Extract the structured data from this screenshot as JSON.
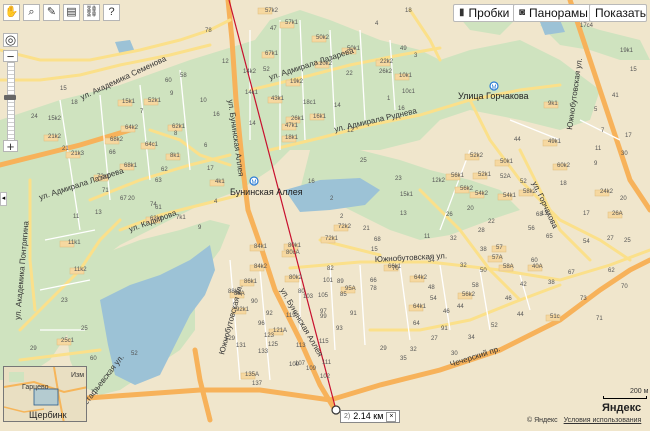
{
  "toolbar": {
    "traffic": "Пробки",
    "panoramas": "Панорамы",
    "show": "Показать"
  },
  "tools": [
    "hand-icon",
    "zoom-area-icon",
    "ruler-icon",
    "print-icon",
    "link-icon",
    "help-icon"
  ],
  "route": {
    "distance": "2.14 км"
  },
  "scale": {
    "label": "200 м"
  },
  "logo": {
    "text": "Яндекс"
  },
  "copyright": {
    "text": "© Яндекс",
    "terms": "Условия использования"
  },
  "minimap": {
    "place1": "Гарцево",
    "place2": "Щербинк",
    "place3": "Изм"
  },
  "streets": {
    "akad_semenova": "ул. Академика Семенова",
    "buninskaya1": "ул. Бунинская Аллея",
    "buninskaya2": "ул. Бунинская Аллея",
    "admirala_lazareva1": "ул. Адмирала Лазарева",
    "admirala_lazareva2": "ул. Адмирала Лазарева",
    "admirala_ruseva": "ул. Адмирала Руднева",
    "kadyrova": "ул. Кадырова",
    "akad_pontryagina": "ул. Академика Понтрягина",
    "yuzhnobutovskaya1": "Южнобутовская ул.",
    "yuzhnobutovskaya2": "Южнобутовская ул.",
    "yuzhnobutovskaya3": "Южнобутовская ул.",
    "gorchakova": "ул. Горчакова",
    "ostafyevskaya": "Остафьевская ул.",
    "chechersky": "Чечерский пр."
  },
  "pois": {
    "metro_gorchakova": "Улица Горчакова",
    "metro_buninskaya": "Бунинская Аллея"
  },
  "houses": [
    [
      "57k2",
      265,
      12
    ],
    [
      "57k1",
      285,
      24
    ],
    [
      "50k2",
      316,
      39
    ],
    [
      "50k1",
      347,
      50
    ],
    [
      "10k2",
      319,
      65
    ],
    [
      "22",
      346,
      75
    ],
    [
      "10k1",
      399,
      77
    ],
    [
      "49",
      400,
      50
    ],
    [
      "22k2",
      380,
      63
    ],
    [
      "67k1",
      265,
      55
    ],
    [
      "19k2",
      290,
      83
    ],
    [
      "43k1",
      271,
      100
    ],
    [
      "26k1",
      291,
      120
    ],
    [
      "16k1",
      313,
      118
    ],
    [
      "47k1",
      285,
      127
    ],
    [
      "18k1",
      285,
      139
    ],
    [
      "1",
      387,
      100
    ],
    [
      "26k2",
      379,
      73
    ],
    [
      "52",
      263,
      71
    ],
    [
      "3",
      414,
      57
    ],
    [
      "4",
      375,
      25
    ],
    [
      "18",
      405,
      12
    ],
    [
      "17c4",
      580,
      27
    ],
    [
      "19k1",
      620,
      52
    ],
    [
      "15",
      630,
      71
    ],
    [
      "41",
      612,
      97
    ],
    [
      "5",
      594,
      111
    ],
    [
      "7",
      601,
      132
    ],
    [
      "30",
      621,
      155
    ],
    [
      "9",
      594,
      165
    ],
    [
      "11",
      595,
      150
    ],
    [
      "17",
      625,
      137
    ],
    [
      "12k2",
      432,
      182
    ],
    [
      "52k2",
      470,
      157
    ],
    [
      "50k1",
      500,
      163
    ],
    [
      "52k1",
      478,
      176
    ],
    [
      "52A",
      500,
      178
    ],
    [
      "54k2",
      475,
      195
    ],
    [
      "56k2",
      460,
      190
    ],
    [
      "56k1",
      451,
      177
    ],
    [
      "52",
      520,
      183
    ],
    [
      "26A",
      612,
      215
    ],
    [
      "20",
      620,
      200
    ],
    [
      "17",
      583,
      215
    ],
    [
      "24k2",
      600,
      193
    ],
    [
      "13",
      541,
      215
    ],
    [
      "18",
      560,
      185
    ],
    [
      "25",
      624,
      242
    ],
    [
      "54k1",
      503,
      197
    ],
    [
      "13",
      400,
      215
    ],
    [
      "15k1",
      400,
      196
    ],
    [
      "11",
      424,
      238
    ],
    [
      "15",
      371,
      251
    ],
    [
      "2",
      330,
      200
    ],
    [
      "21",
      363,
      230
    ],
    [
      "2",
      340,
      218
    ],
    [
      "23",
      395,
      180
    ],
    [
      "25",
      360,
      162
    ],
    [
      "16",
      308,
      183
    ],
    [
      "72k1",
      325,
      240
    ],
    [
      "72k2",
      338,
      228
    ],
    [
      "80k1",
      288,
      247
    ],
    [
      "80cA",
      286,
      254
    ],
    [
      "80k2",
      289,
      279
    ],
    [
      "82",
      327,
      270
    ],
    [
      "84k1",
      254,
      248
    ],
    [
      "84k2",
      254,
      268
    ],
    [
      "86k1",
      244,
      283
    ],
    [
      "86A",
      234,
      295
    ],
    [
      "88k2",
      228,
      293
    ],
    [
      "90",
      251,
      303
    ],
    [
      "92",
      266,
      315
    ],
    [
      "92k1",
      236,
      311
    ],
    [
      "96",
      258,
      325
    ],
    [
      "101",
      323,
      282
    ],
    [
      "103",
      303,
      298
    ],
    [
      "105",
      318,
      297
    ],
    [
      "85",
      340,
      296
    ],
    [
      "95A",
      345,
      290
    ],
    [
      "99",
      320,
      318
    ],
    [
      "64k1",
      413,
      308
    ],
    [
      "64",
      413,
      325
    ],
    [
      "93",
      336,
      330
    ],
    [
      "97",
      320,
      313
    ],
    [
      "91",
      350,
      315
    ],
    [
      "54",
      430,
      300
    ],
    [
      "46",
      443,
      313
    ],
    [
      "44",
      457,
      308
    ],
    [
      "48",
      428,
      289
    ],
    [
      "66",
      370,
      282
    ],
    [
      "64k2",
      414,
      279
    ],
    [
      "66k1",
      388,
      268
    ],
    [
      "56k2",
      462,
      296
    ],
    [
      "58",
      472,
      287
    ],
    [
      "58A",
      503,
      268
    ],
    [
      "60",
      531,
      262
    ],
    [
      "57A",
      492,
      259
    ],
    [
      "57",
      496,
      249
    ],
    [
      "42",
      520,
      286
    ],
    [
      "40A",
      532,
      268
    ],
    [
      "38",
      548,
      284
    ],
    [
      "50",
      480,
      272
    ],
    [
      "68",
      374,
      241
    ],
    [
      "70",
      392,
      270
    ],
    [
      "46",
      505,
      300
    ],
    [
      "107",
      295,
      365
    ],
    [
      "109",
      306,
      370
    ],
    [
      "111",
      322,
      364
    ],
    [
      "113",
      296,
      347
    ],
    [
      "115",
      319,
      343
    ],
    [
      "121A",
      273,
      332
    ],
    [
      "123",
      264,
      337
    ],
    [
      "125",
      268,
      346
    ],
    [
      "131",
      236,
      347
    ],
    [
      "133",
      258,
      353
    ],
    [
      "135A",
      245,
      376
    ],
    [
      "137",
      252,
      385
    ],
    [
      "129",
      225,
      340
    ],
    [
      "119",
      286,
      317
    ],
    [
      "100",
      289,
      366
    ],
    [
      "102",
      320,
      378
    ],
    [
      "80",
      298,
      293
    ],
    [
      "89",
      337,
      283
    ],
    [
      "78",
      370,
      290
    ],
    [
      "51c",
      550,
      318
    ],
    [
      "62",
      608,
      272
    ],
    [
      "70",
      621,
      288
    ],
    [
      "27",
      431,
      340
    ],
    [
      "29",
      380,
      350
    ],
    [
      "32",
      410,
      351
    ],
    [
      "35",
      400,
      360
    ],
    [
      "15",
      60,
      90
    ],
    [
      "24",
      31,
      118
    ],
    [
      "15k1",
      122,
      103
    ],
    [
      "52k1",
      148,
      102
    ],
    [
      "62k1",
      172,
      128
    ],
    [
      "64c1",
      145,
      146
    ],
    [
      "64k2",
      125,
      129
    ],
    [
      "68k2",
      110,
      141
    ],
    [
      "68k1",
      124,
      167
    ],
    [
      "66",
      109,
      154
    ],
    [
      "62",
      161,
      171
    ],
    [
      "63",
      155,
      182
    ],
    [
      "8k1",
      170,
      157
    ],
    [
      "6",
      204,
      147
    ],
    [
      "8",
      174,
      135
    ],
    [
      "17",
      207,
      170
    ],
    [
      "4k1",
      215,
      183
    ],
    [
      "4",
      214,
      203
    ],
    [
      "74",
      150,
      206
    ],
    [
      "63k1",
      150,
      220
    ],
    [
      "61",
      155,
      209
    ],
    [
      "72c1",
      97,
      178
    ],
    [
      "71",
      102,
      192
    ],
    [
      "21k3",
      71,
      155
    ],
    [
      "21k2",
      48,
      138
    ],
    [
      "21",
      62,
      150
    ],
    [
      "18",
      71,
      104
    ],
    [
      "15k2",
      48,
      120
    ],
    [
      "20",
      128,
      200
    ],
    [
      "11",
      73,
      218
    ],
    [
      "13",
      95,
      214
    ],
    [
      "11k1",
      68,
      244
    ],
    [
      "11k2",
      74,
      271
    ],
    [
      "23",
      61,
      302
    ],
    [
      "25c1",
      61,
      342
    ],
    [
      "25",
      81,
      330
    ],
    [
      "29",
      30,
      350
    ],
    [
      "60",
      90,
      360
    ],
    [
      "52",
      131,
      355
    ],
    [
      "7",
      140,
      113
    ],
    [
      "10c1",
      402,
      93
    ],
    [
      "16",
      398,
      110
    ],
    [
      "9",
      170,
      95
    ],
    [
      "18c1",
      303,
      104
    ],
    [
      "14",
      334,
      107
    ],
    [
      "12",
      347,
      132
    ],
    [
      "58",
      180,
      77
    ],
    [
      "60",
      165,
      82
    ],
    [
      "14k2",
      243,
      73
    ],
    [
      "14k1",
      245,
      94
    ],
    [
      "78",
      205,
      32
    ],
    [
      "14",
      249,
      125
    ],
    [
      "12",
      222,
      63
    ],
    [
      "10",
      200,
      102
    ],
    [
      "16",
      213,
      116
    ],
    [
      "67",
      120,
      200
    ],
    [
      "7k1",
      176,
      219
    ],
    [
      "9",
      198,
      229
    ],
    [
      "47",
      270,
      30
    ],
    [
      "9k1",
      548,
      105
    ],
    [
      "49k1",
      548,
      143
    ],
    [
      "44",
      514,
      141
    ],
    [
      "60k2",
      557,
      167
    ],
    [
      "58k2",
      523,
      193
    ],
    [
      "56",
      528,
      230
    ],
    [
      "68",
      536,
      216
    ],
    [
      "54",
      583,
      243
    ],
    [
      "65",
      546,
      238
    ],
    [
      "27",
      607,
      240
    ],
    [
      "67",
      568,
      274
    ],
    [
      "73",
      580,
      300
    ],
    [
      "71",
      596,
      320
    ],
    [
      "32",
      450,
      240
    ],
    [
      "26",
      446,
      216
    ],
    [
      "20",
      467,
      210
    ],
    [
      "22",
      488,
      223
    ],
    [
      "28",
      478,
      232
    ],
    [
      "34",
      428,
      262
    ],
    [
      "32",
      460,
      267
    ],
    [
      "38",
      480,
      251
    ],
    [
      "52",
      491,
      327
    ],
    [
      "44",
      517,
      316
    ],
    [
      "91",
      441,
      330
    ],
    [
      "34",
      468,
      339
    ],
    [
      "30",
      451,
      355
    ]
  ]
}
